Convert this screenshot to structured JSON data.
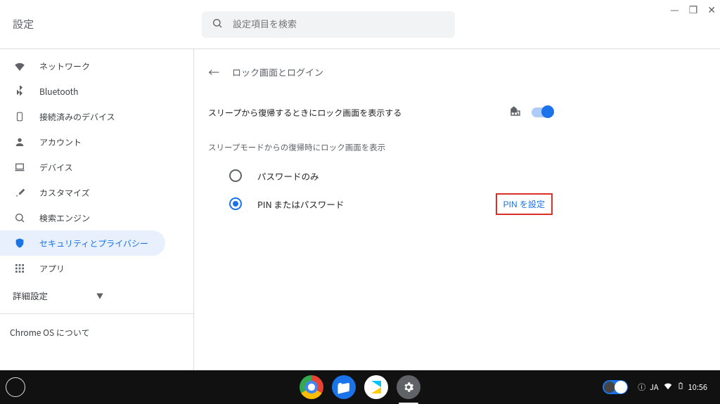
{
  "window_controls": {
    "minimize": "—",
    "maximize": "❐",
    "close": "✕"
  },
  "header": {
    "title": "設定",
    "search_placeholder": "設定項目を検索"
  },
  "sidebar": {
    "items": [
      {
        "id": "network",
        "label": "ネットワーク",
        "active": false
      },
      {
        "id": "bluetooth",
        "label": "Bluetooth",
        "active": false
      },
      {
        "id": "devices",
        "label": "接続済みのデバイス",
        "active": false
      },
      {
        "id": "account",
        "label": "アカウント",
        "active": false
      },
      {
        "id": "device",
        "label": "デバイス",
        "active": false
      },
      {
        "id": "customize",
        "label": "カスタマイズ",
        "active": false
      },
      {
        "id": "search",
        "label": "検索エンジン",
        "active": false
      },
      {
        "id": "security",
        "label": "セキュリティとプライバシー",
        "active": true
      },
      {
        "id": "apps",
        "label": "アプリ",
        "active": false
      }
    ],
    "advanced_label": "詳細設定",
    "about_label": "Chrome OS について"
  },
  "page": {
    "title": "ロック画面とログイン",
    "lock_on_sleep_label": "スリープから復帰するときにロック画面を表示する",
    "lock_on_sleep_enabled": true,
    "managed_by_enterprise": true,
    "section_label": "スリープモードからの復帰時にロック画面を表示",
    "radio_password_only": "パスワードのみ",
    "radio_pin_or_password": "PIN またはパスワード",
    "selected_option": "pin_or_password",
    "pin_setup_button": "PIN を設定"
  },
  "shelf": {
    "ime_label": "JA",
    "time": "10:56",
    "info_glyph": "ⓘ"
  }
}
